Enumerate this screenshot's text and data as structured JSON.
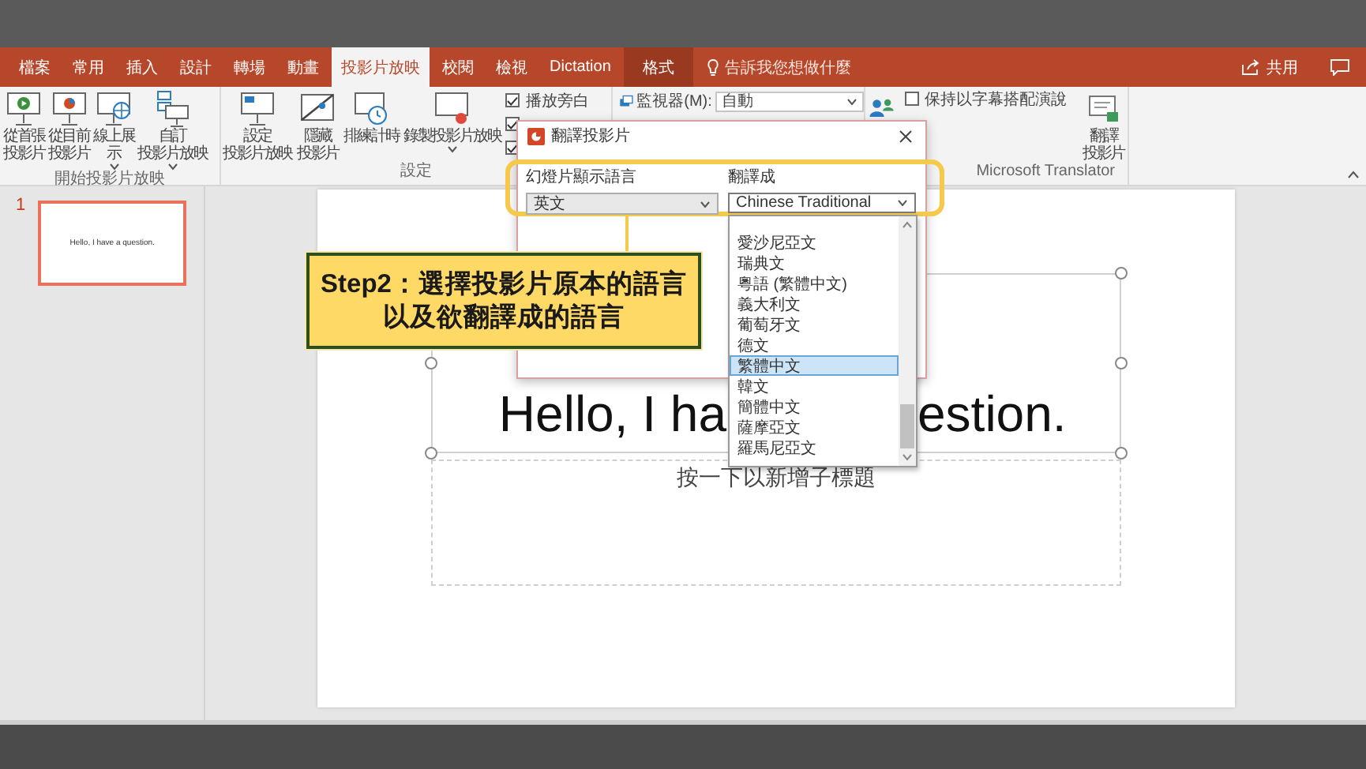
{
  "tabs": [
    {
      "label": "檔案",
      "selected": false,
      "kind": "file"
    },
    {
      "label": "常用",
      "selected": false,
      "kind": "normal"
    },
    {
      "label": "插入",
      "selected": false,
      "kind": "normal"
    },
    {
      "label": "設計",
      "selected": false,
      "kind": "normal"
    },
    {
      "label": "轉場",
      "selected": false,
      "kind": "normal"
    },
    {
      "label": "動畫",
      "selected": false,
      "kind": "normal"
    },
    {
      "label": "投影片放映",
      "selected": true,
      "kind": "normal"
    },
    {
      "label": "校閱",
      "selected": false,
      "kind": "normal"
    },
    {
      "label": "檢視",
      "selected": false,
      "kind": "normal"
    },
    {
      "label": "Dictation",
      "selected": false,
      "kind": "normal"
    },
    {
      "label": "格式",
      "selected": false,
      "kind": "contextual"
    }
  ],
  "tell_me": "告訴我您想做什麼",
  "share": "共用",
  "ribbon": {
    "start_group": {
      "label": "開始投影片放映",
      "buttons": [
        {
          "lines": [
            "從首張",
            "投影片"
          ],
          "dropdown": false
        },
        {
          "lines": [
            "從目前",
            "投影片"
          ],
          "dropdown": false
        },
        {
          "lines": [
            "線上展",
            "示"
          ],
          "dropdown": true
        },
        {
          "lines": [
            "自訂",
            "投影片放映"
          ],
          "dropdown": true
        }
      ]
    },
    "setup_group": {
      "label": "設定",
      "buttons": [
        {
          "lines": [
            "設定",
            "投影片放映"
          ],
          "dropdown": false
        },
        {
          "lines": [
            "隱藏",
            "投影片"
          ],
          "dropdown": false
        },
        {
          "lines": [
            "排練計時"
          ],
          "dropdown": false
        },
        {
          "lines": [
            "錄製投影片放映"
          ],
          "dropdown": true
        }
      ],
      "checkboxes": [
        {
          "label": "播放旁白",
          "checked": true
        },
        {
          "checked": true
        },
        {
          "checked": true
        }
      ]
    },
    "monitor": {
      "label": "監視器(M):",
      "value": "自動"
    },
    "translator_group": {
      "label": "Microsoft Translator",
      "subtitle_checkbox": {
        "label": "保持以字幕搭配演說",
        "checked": false
      },
      "button": {
        "lines": [
          "翻譯",
          "投影片"
        ]
      }
    }
  },
  "slides": [
    {
      "number": "1",
      "title": "Hello, I have a question.",
      "selected": true
    }
  ],
  "slide": {
    "title_visible_left": "Hello, I ha",
    "title_visible_right": "estion.",
    "subtitle_placeholder": "按一下以新增子標題"
  },
  "dialog": {
    "title": "翻譯投影片",
    "source_label": "幻燈片顯示語言",
    "source_value": "英文",
    "target_label": "翻譯成",
    "target_value": "Chinese Traditional",
    "options": [
      {
        "label": "愛沙尼亞文",
        "selected": false
      },
      {
        "label": "瑞典文",
        "selected": false
      },
      {
        "label": "粵語 (繁體中文)",
        "selected": false
      },
      {
        "label": "義大利文",
        "selected": false
      },
      {
        "label": "葡萄牙文",
        "selected": false
      },
      {
        "label": "德文",
        "selected": false
      },
      {
        "label": "繁體中文",
        "selected": true
      },
      {
        "label": "韓文",
        "selected": false
      },
      {
        "label": "簡體中文",
        "selected": false
      },
      {
        "label": "薩摩亞文",
        "selected": false
      },
      {
        "label": "羅馬尼亞文",
        "selected": false
      }
    ]
  },
  "callout": "Step2：選擇投影片原本的語言以及欲翻譯成的語言"
}
